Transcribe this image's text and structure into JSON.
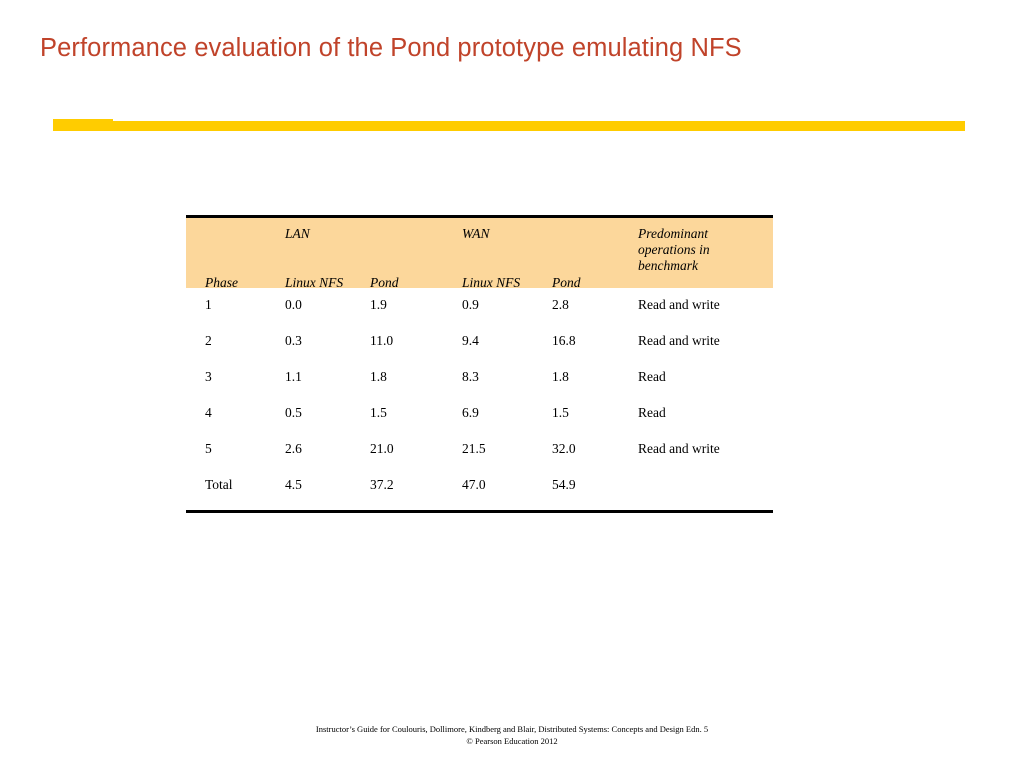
{
  "slide": {
    "title": "Performance evaluation of the Pond prototype emulating NFS",
    "title_color": "#C0432A",
    "accent_bar_color": "#FFCC00",
    "header_background_color": "#FCD79B",
    "background_color": "#FFFFFF"
  },
  "table": {
    "group_headers": {
      "phase": "Phase",
      "lan": "LAN",
      "wan": "WAN",
      "predominant": "Predominant operations in benchmark"
    },
    "sub_headers": {
      "lan_linux_nfs": "Linux NFS",
      "lan_pond": "Pond",
      "wan_linux_nfs": "Linux NFS",
      "wan_pond": "Pond"
    },
    "columns": [
      "Phase",
      "Linux NFS",
      "Pond",
      "Linux NFS",
      "Pond",
      "Predominant operations in benchmark"
    ],
    "rows": [
      {
        "phase": "1",
        "lan_linux_nfs": "0.0",
        "lan_pond": "1.9",
        "wan_linux_nfs": "0.9",
        "wan_pond": "2.8",
        "operations": "Read and write"
      },
      {
        "phase": "2",
        "lan_linux_nfs": "0.3",
        "lan_pond": "11.0",
        "wan_linux_nfs": "9.4",
        "wan_pond": "16.8",
        "operations": "Read and write"
      },
      {
        "phase": "3",
        "lan_linux_nfs": "1.1",
        "lan_pond": "1.8",
        "wan_linux_nfs": "8.3",
        "wan_pond": "1.8",
        "operations": "Read"
      },
      {
        "phase": "4",
        "lan_linux_nfs": "0.5",
        "lan_pond": "1.5",
        "wan_linux_nfs": "6.9",
        "wan_pond": "1.5",
        "operations": "Read"
      },
      {
        "phase": "5",
        "lan_linux_nfs": "2.6",
        "lan_pond": "21.0",
        "wan_linux_nfs": "21.5",
        "wan_pond": "32.0",
        "operations": "Read and write"
      },
      {
        "phase": "Total",
        "lan_linux_nfs": "4.5",
        "lan_pond": "37.2",
        "wan_linux_nfs": "47.0",
        "wan_pond": "54.9",
        "operations": ""
      }
    ]
  },
  "footer": {
    "line1": "Instructor’s Guide for  Coulouris, Dollimore, Kindberg and Blair,  Distributed Systems: Concepts and Design   Edn. 5",
    "line2": "©  Pearson Education 2012"
  }
}
